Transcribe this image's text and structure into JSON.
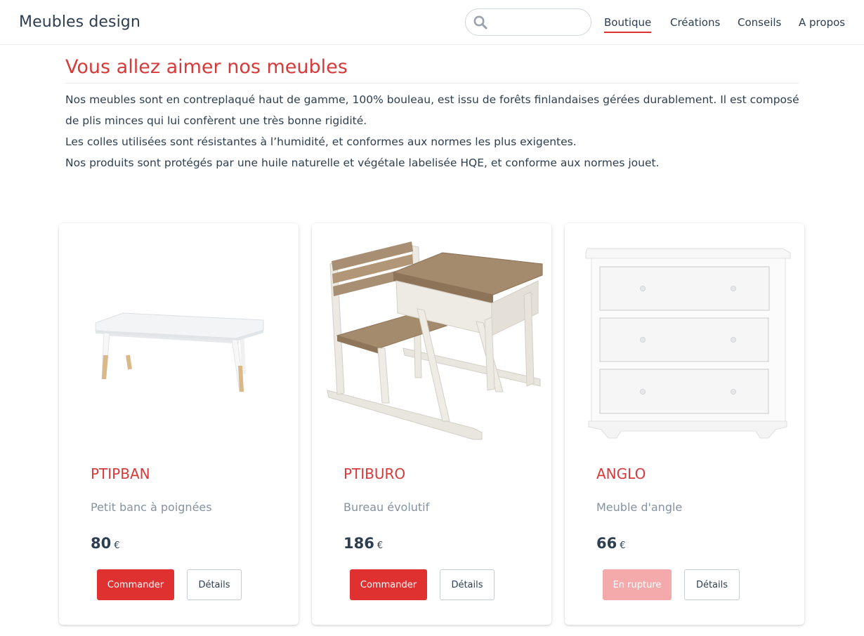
{
  "header": {
    "brand": "Meubles design",
    "search": {
      "value": "",
      "placeholder": ""
    },
    "nav": [
      {
        "label": "Boutique",
        "active": true
      },
      {
        "label": "Créations"
      },
      {
        "label": "Conseils"
      },
      {
        "label": "A propos"
      }
    ]
  },
  "intro": {
    "title": "Vous allez aimer nos meubles",
    "lines": [
      "Nos meubles sont en contreplaqué haut de gamme, 100% bouleau, est issu de forêts finlandaises gérées durablement. Il est composé de plis minces qui lui confèrent une très bonne rigidité.",
      "Les colles utilisées sont résistantes à l’humidité, et conformes aux normes les plus exigentes.",
      "Nos produits sont protégés par une huile naturelle et végétale labelisée HQE, et conforme aux normes jouet."
    ]
  },
  "products": [
    {
      "name": "PTIPBAN",
      "description": "Petit banc à poignées",
      "price": "80",
      "currency": "€",
      "action_label": "Commander",
      "in_stock": true,
      "details_label": "Détails",
      "image": "bench-image"
    },
    {
      "name": "PTIBURO",
      "description": "Bureau évolutif",
      "price": "186",
      "currency": "€",
      "action_label": "Commander",
      "in_stock": true,
      "details_label": "Détails",
      "image": "desk-image"
    },
    {
      "name": "ANGLO",
      "description": "Meuble d'angle",
      "price": "66",
      "currency": "€",
      "action_label": "En rupture",
      "in_stock": false,
      "details_label": "Détails",
      "image": "dresser-image"
    }
  ],
  "colors": {
    "accent": "#e03131",
    "accent_disabled": "#f4aaaa",
    "title_red": "#d63a3a",
    "text": "#2c3e50",
    "muted": "#8592a0"
  }
}
